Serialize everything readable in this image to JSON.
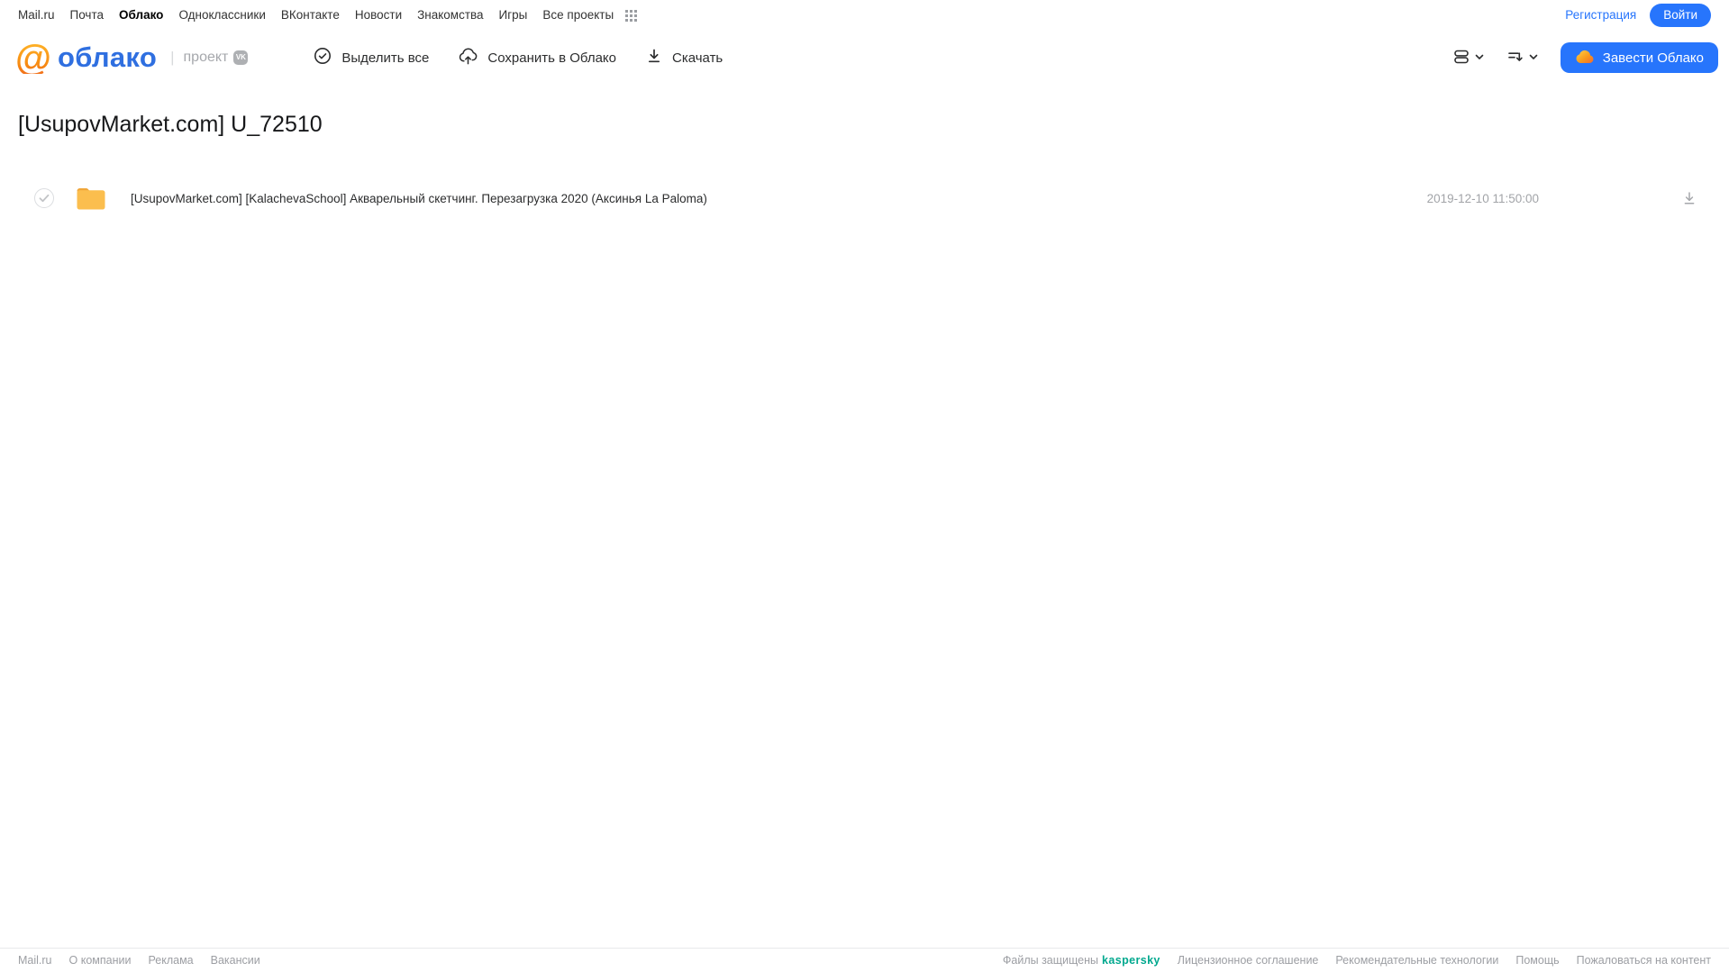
{
  "topnav": {
    "items": [
      "Mail.ru",
      "Почта",
      "Облако",
      "Одноклассники",
      "ВКонтакте",
      "Новости",
      "Знакомства",
      "Игры",
      "Все проекты"
    ],
    "active_item": "Облако",
    "registration_label": "Регистрация",
    "login_label": "Войти"
  },
  "header": {
    "logo_at": "@",
    "logo_text": "облако",
    "project_label": "проект",
    "vk_badge": "VK",
    "toolbar": {
      "select_all": "Выделить все",
      "save_to_cloud": "Сохранить в Облако",
      "download": "Скачать"
    },
    "get_cloud_label": "Завести Облако"
  },
  "page": {
    "title": "[UsupovMarket.com] U_72510"
  },
  "files": [
    {
      "type": "folder",
      "name": "[UsupovMarket.com] [KalachevaSchool] Акварельный скетчинг. Перезагрузка 2020 (Аксинья La Paloma)",
      "date": "2019-12-10 11:50:00"
    }
  ],
  "footer": {
    "left_links": [
      "Mail.ru",
      "О компании",
      "Реклама",
      "Вакансии"
    ],
    "protected_label": "Файлы защищены",
    "kaspersky_label": "kaspersky",
    "right_links": [
      "Лицензионное соглашение",
      "Рекомендательные технологии",
      "Помощь",
      "Пожаловаться на контент"
    ]
  },
  "icons": {
    "apps_grid": "apps-grid-icon",
    "select_all": "check-circle-icon",
    "save_to_cloud": "cloud-upload-icon",
    "download": "download-arrow-icon",
    "view_toggle": "list-view-icon",
    "sort": "sort-icon",
    "chevron": "chevron-down-icon",
    "cta_cloud": "cloud-icon",
    "folder": "folder-icon",
    "checkbox": "checkbox-circle-icon"
  },
  "colors": {
    "accent_blue": "#2775FC",
    "logo_blue": "#2F6FE0",
    "logo_orange": "#F89C1C",
    "folder_yellow": "#FBBE4E",
    "kaspersky_green": "#00A88E",
    "muted_gray": "#A2A4A8"
  }
}
